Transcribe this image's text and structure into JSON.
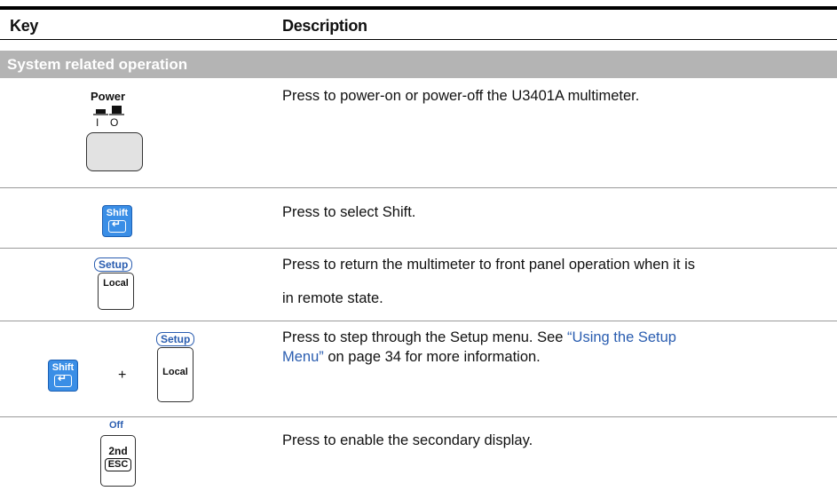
{
  "table": {
    "header": {
      "key": "Key",
      "description": "Description"
    },
    "section": "System related operation",
    "rows": [
      {
        "keys": {
          "power_label": "Power",
          "on_mark": "I",
          "off_mark": "O"
        },
        "description": "Press to power-on or power-off the U3401A multimeter."
      },
      {
        "keys": {
          "shift": "Shift"
        },
        "description": "Press to select Shift."
      },
      {
        "keys": {
          "setup": "Setup",
          "local": "Local"
        },
        "description_line1": "Press to return the multimeter to front panel operation when it is",
        "description_line2": "in remote state."
      },
      {
        "keys": {
          "shift": "Shift",
          "plus": "+",
          "setup": "Setup",
          "local": "Local"
        },
        "description_before": "Press to step through the Setup menu. See ",
        "link_line1": "“Using the Setup",
        "link_line2": "Menu”",
        "description_after": " on page 34 for more information."
      },
      {
        "keys": {
          "off": "Off",
          "second": "2nd",
          "esc": "ESC"
        },
        "description": "Press to enable the secondary display."
      }
    ]
  },
  "colors": {
    "section_bg": "#b4b4b4",
    "link": "#2a5db0",
    "shift_key": "#3a8ee6",
    "power_key": "#e2e2e2"
  },
  "icons": [
    "power-switch-icon",
    "enter-icon"
  ]
}
